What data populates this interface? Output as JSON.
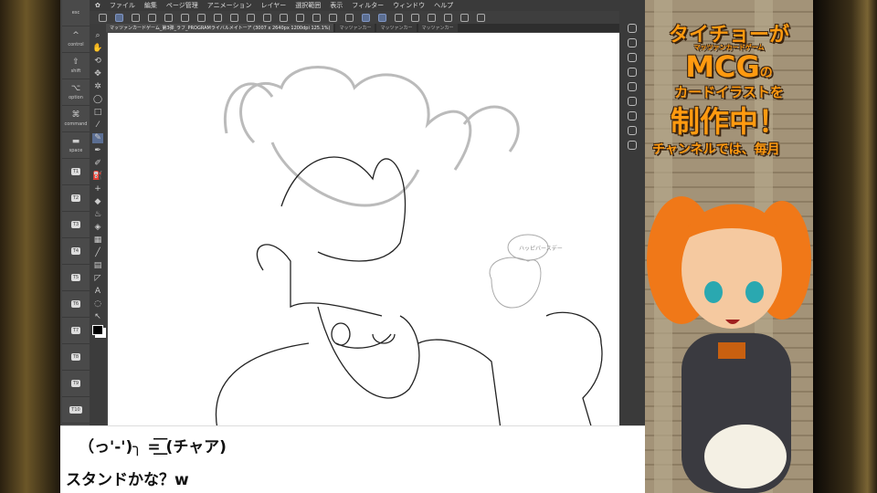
{
  "menu": [
    "ファイル",
    "編集",
    "ページ管理",
    "アニメーション",
    "レイヤー",
    "選択範囲",
    "表示",
    "フィルター",
    "ウィンドウ",
    "ヘルプ"
  ],
  "tabs": [
    "マッツァンカードゲーム_第3弾_ラフ_PROGRAMライバルメイトーア (3007 x 2640px 1200dpi 125.1%)",
    "マッツァンカー",
    "マッツァンカー",
    "マッツァンカー"
  ],
  "keys": [
    {
      "icon": "⎋",
      "label": "esc"
    },
    {
      "icon": "^",
      "label": "control"
    },
    {
      "icon": "⇧",
      "label": "shift"
    },
    {
      "icon": "⌥",
      "label": "option"
    },
    {
      "icon": "⌘",
      "label": "command"
    },
    {
      "icon": "▬",
      "label": "space"
    },
    {
      "label": "T1"
    },
    {
      "label": "T2"
    },
    {
      "label": "T3"
    },
    {
      "label": "T4"
    },
    {
      "label": "T5"
    },
    {
      "label": "T6"
    },
    {
      "label": "T7"
    },
    {
      "label": "T8"
    },
    {
      "label": "T9"
    },
    {
      "label": "T10"
    }
  ],
  "chat": {
    "line1": "（っ'-')╮ =͟͟͞͞ (チャア)",
    "line2": "スタンドかな？w"
  },
  "canvas": {
    "note": "ハッピバースデー"
  },
  "overlay": {
    "line1": "タイチョーが",
    "ruby": "マッツァンカードゲーム",
    "line2": "MCG",
    "line2b": "の",
    "line3": "カードイラストを",
    "line4": "制作中！",
    "ticker": "チャンネルでは、毎月"
  },
  "colors": {
    "accent": "#ff9a10",
    "ui": "#434343",
    "selected": "#5b6e92"
  }
}
